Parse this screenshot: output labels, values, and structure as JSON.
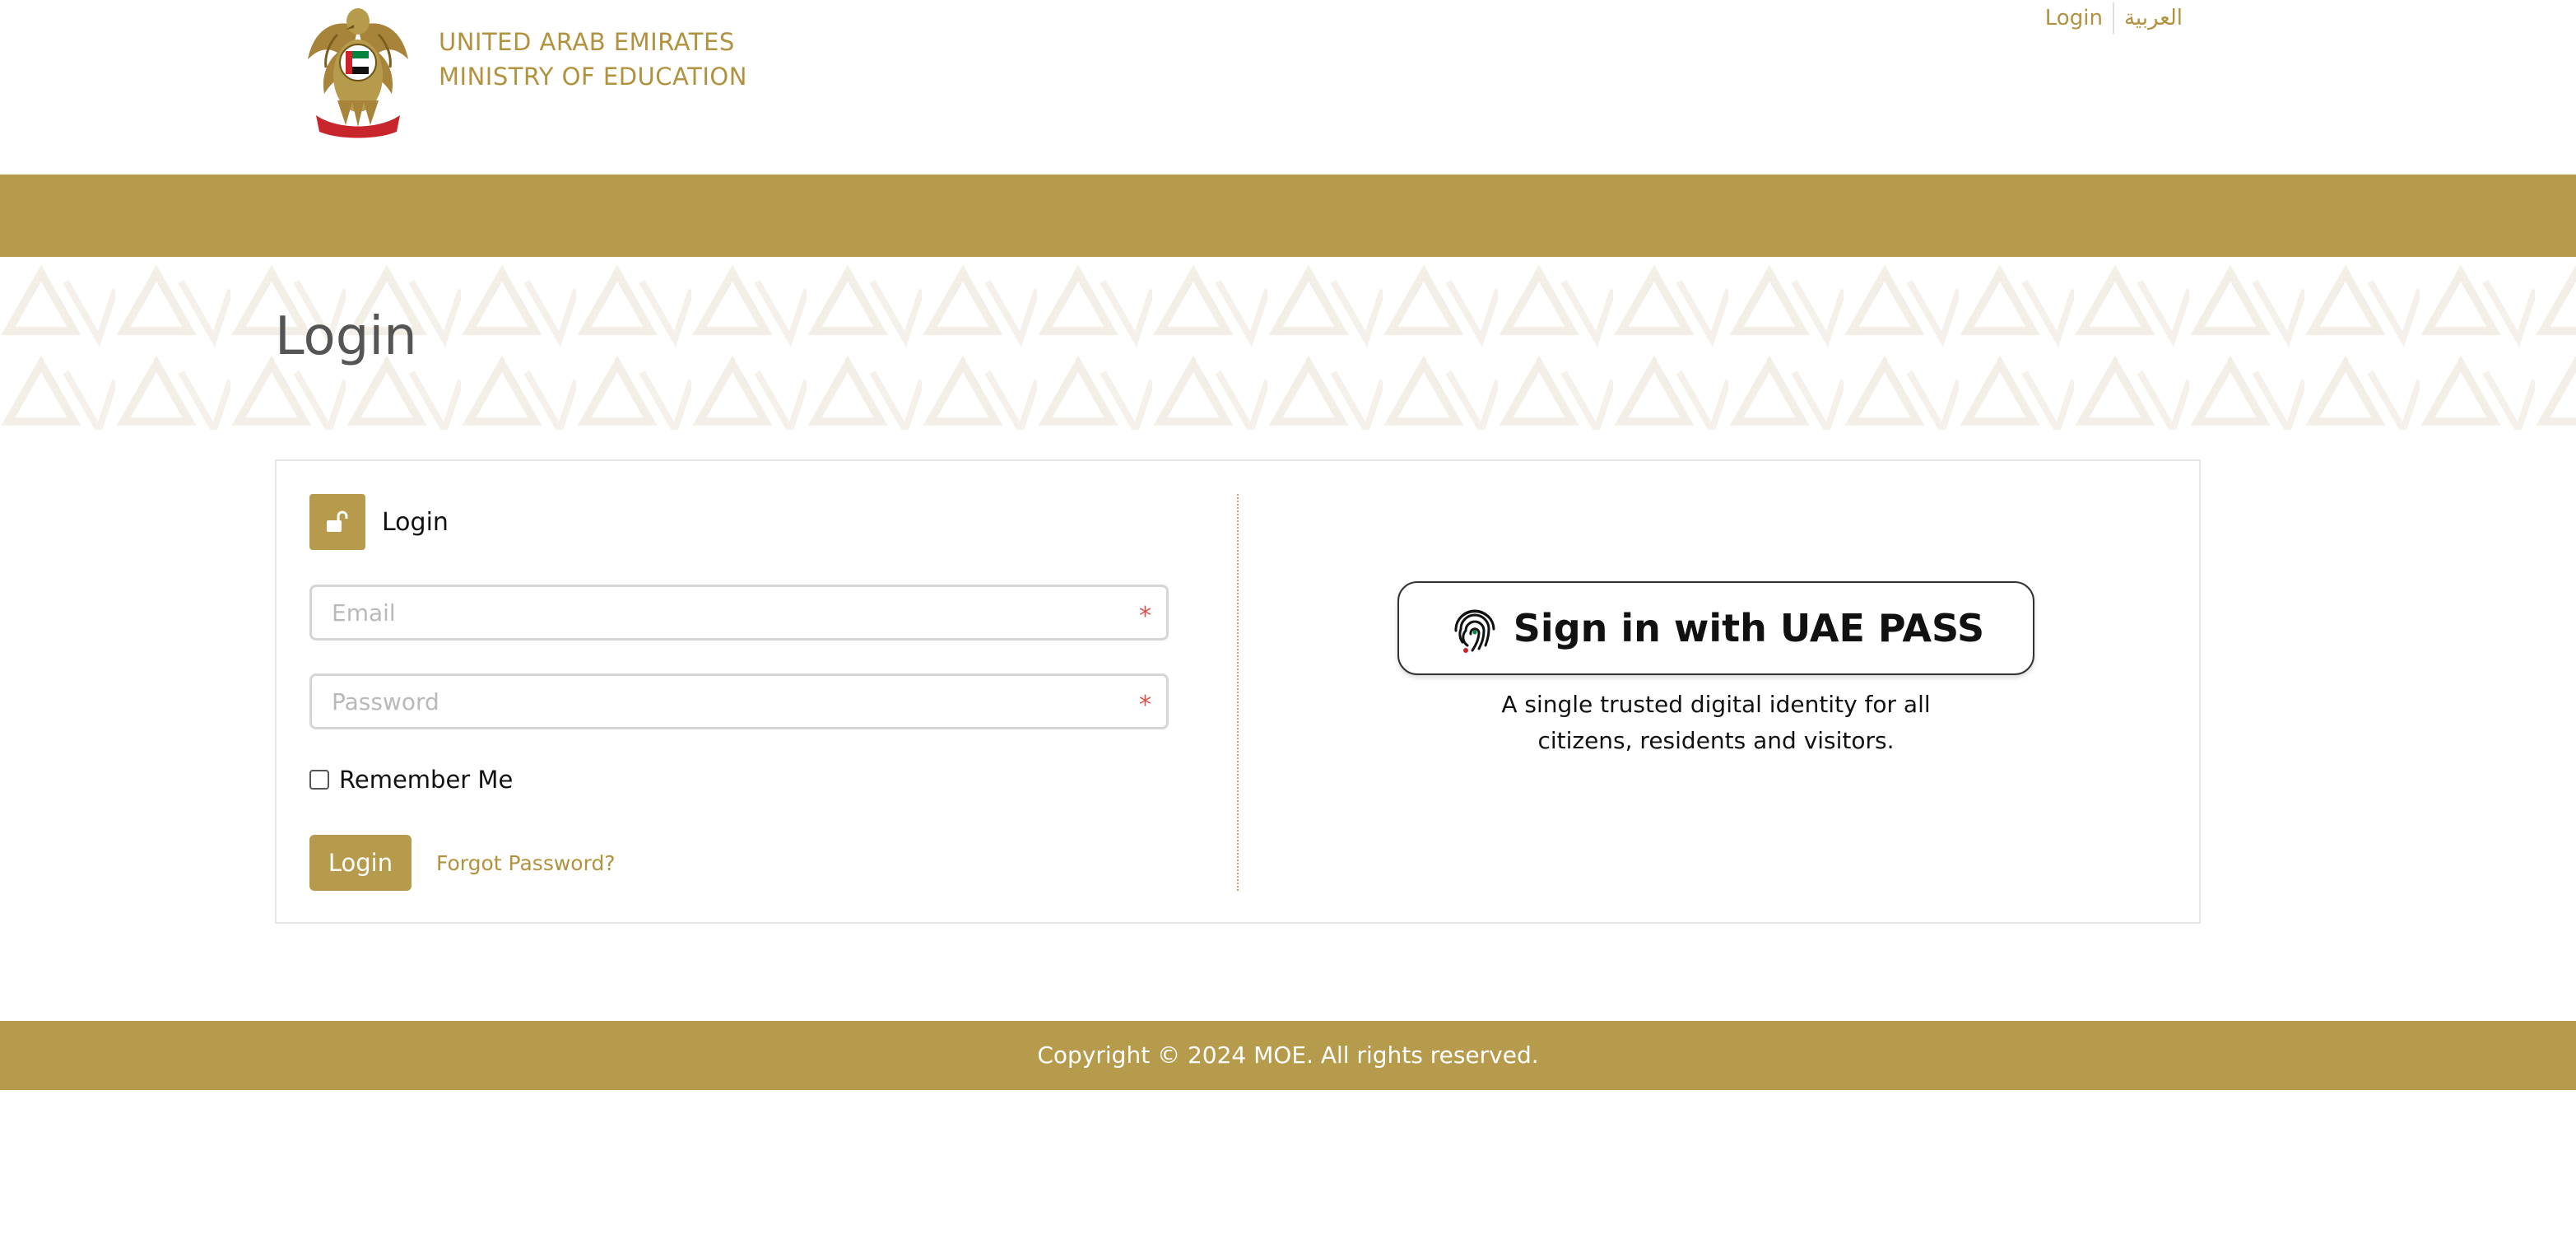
{
  "header": {
    "org_line1": "UNITED ARAB EMIRATES",
    "org_line2": "MINISTRY OF EDUCATION",
    "emblem_icon": "uae-eagle-emblem",
    "links": {
      "login": "Login",
      "arabic": "العربية"
    }
  },
  "page": {
    "title": "Login"
  },
  "login_form": {
    "heading": "Login",
    "heading_icon": "unlock-icon",
    "email": {
      "value": "",
      "placeholder": "Email",
      "required_mark": "*"
    },
    "password": {
      "value": "",
      "placeholder": "Password",
      "required_mark": "*"
    },
    "remember_me": {
      "label": "Remember Me",
      "checked": false
    },
    "submit_label": "Login",
    "forgot_label": "Forgot Password?"
  },
  "uae_pass": {
    "button_label": "Sign in with UAE PASS",
    "button_icon": "fingerprint-icon",
    "description_line1": "A single trusted digital identity for all",
    "description_line2": "citizens, residents and visitors."
  },
  "footer": {
    "copyright": "Copyright © 2024 MOE. All rights reserved."
  },
  "colors": {
    "brand_gold": "#b79b4d",
    "link_gold": "#b1923f",
    "required_red": "#d9534f"
  }
}
